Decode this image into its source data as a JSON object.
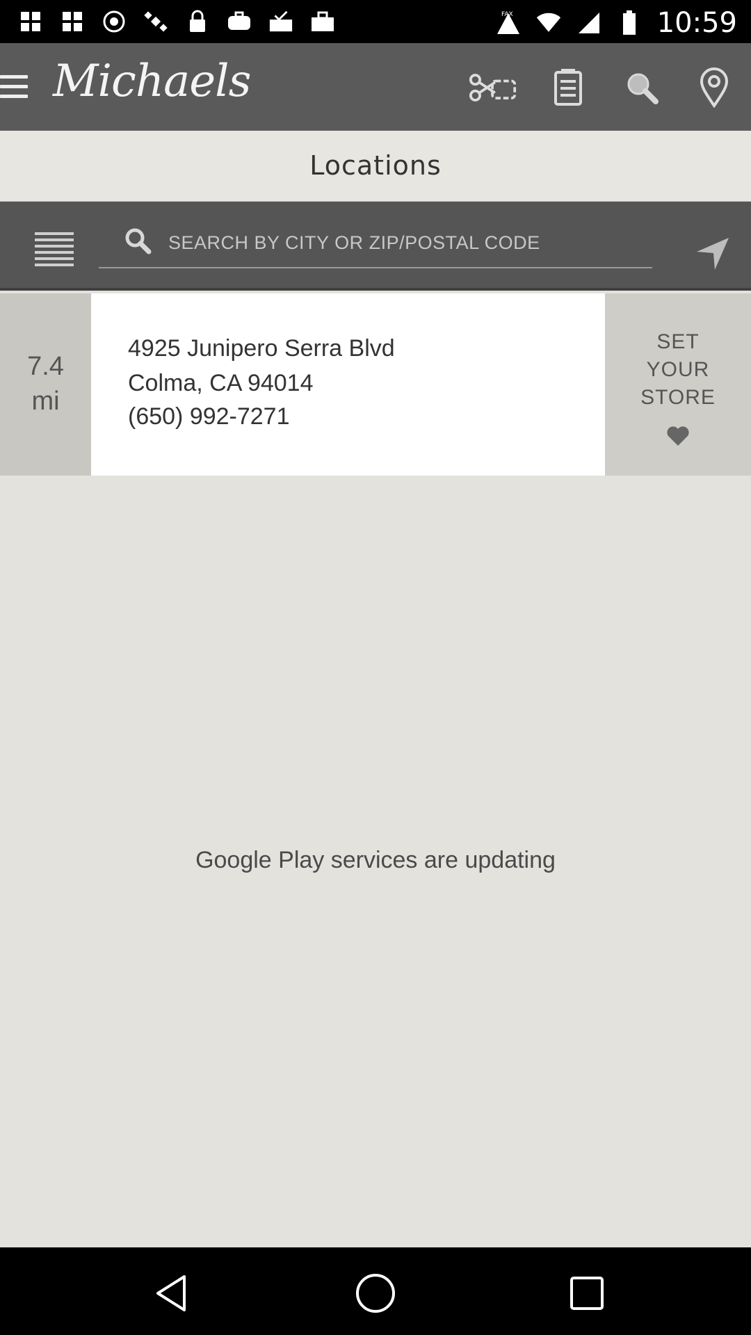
{
  "status_bar": {
    "time": "10:59",
    "left_icons": [
      "grid-icon",
      "grid-icon",
      "record-icon",
      "satellite-icon",
      "lock-icon",
      "briefcase-icon",
      "mail-check-icon",
      "tray-upload-icon",
      "bag-icon"
    ],
    "right_icons": [
      "fax-icon",
      "wifi-icon",
      "signal-icon",
      "battery-icon"
    ]
  },
  "app_bar": {
    "logo": "Michaels",
    "icons": [
      "scissors-coupon-icon",
      "shopping-list-icon",
      "search-icon",
      "location-pin-icon"
    ]
  },
  "header": {
    "title": "Locations"
  },
  "search": {
    "placeholder": "SEARCH BY CITY OR ZIP/POSTAL CODE"
  },
  "store": {
    "distance_value": "7.4",
    "distance_unit": "mi",
    "address_line1": "4925 Junipero Serra Blvd",
    "address_line2": "Colma, CA 94014",
    "phone": "(650) 992-7271",
    "set_store_line1": "SET",
    "set_store_line2": "YOUR",
    "set_store_line3": "STORE"
  },
  "main": {
    "message": "Google Play services are updating"
  },
  "nav_bar": {
    "buttons": [
      "back-icon",
      "home-icon",
      "recents-icon"
    ]
  }
}
